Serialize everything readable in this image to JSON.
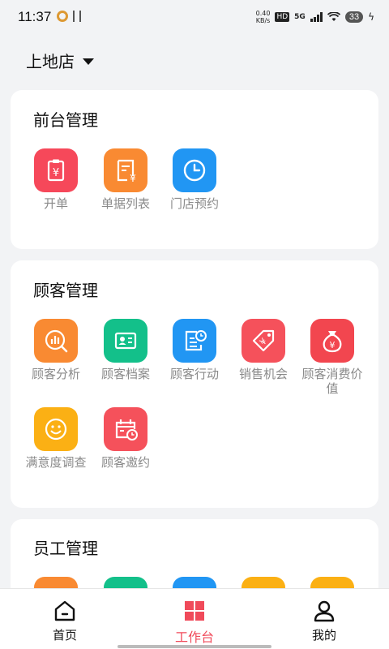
{
  "status_bar": {
    "time": "11:37",
    "net_speed_value": "0.40",
    "net_speed_unit": "KB/s",
    "hd": "HD",
    "network": "5G",
    "battery": "33",
    "left_icons": [
      "sync-icon",
      "usb-icon"
    ],
    "right_icons": [
      "signal-icon",
      "wifi-icon",
      "battery-icon",
      "charging-icon"
    ]
  },
  "store_selector": {
    "name": "上地店",
    "icon": "dropdown-caret-icon"
  },
  "sections": [
    {
      "title": "前台管理",
      "items": [
        {
          "label": "开单",
          "icon": "clipboard-yen-icon",
          "color": "#f6485a"
        },
        {
          "label": "单据列表",
          "icon": "receipt-list-icon",
          "color": "#f98a32"
        },
        {
          "label": "门店预约",
          "icon": "clock-icon",
          "color": "#2196f3"
        }
      ]
    },
    {
      "title": "顾客管理",
      "items": [
        {
          "label": "顾客分析",
          "icon": "chart-analysis-icon",
          "color": "#f98a32"
        },
        {
          "label": "顾客档案",
          "icon": "id-card-icon",
          "color": "#13c08a"
        },
        {
          "label": "顾客行动",
          "icon": "document-clock-icon",
          "color": "#2196f3"
        },
        {
          "label": "销售机会",
          "icon": "price-tag-icon",
          "color": "#f5515b"
        },
        {
          "label": "顾客消费价值",
          "icon": "money-bag-icon",
          "color": "#f2464f"
        },
        {
          "label": "满意度调查",
          "icon": "smiley-icon",
          "color": "#fbb014"
        },
        {
          "label": "顾客邀约",
          "icon": "calendar-clock-icon",
          "color": "#f5515b"
        }
      ]
    },
    {
      "title": "员工管理",
      "items": [
        {
          "icon": "tile-icon",
          "color": "#f98a32"
        },
        {
          "icon": "tile-icon",
          "color": "#13c08a"
        },
        {
          "icon": "tile-icon",
          "color": "#2196f3"
        },
        {
          "icon": "tile-icon",
          "color": "#fbb014"
        },
        {
          "icon": "tile-icon",
          "color": "#fbb014"
        }
      ]
    }
  ],
  "tab_bar": {
    "tabs": [
      {
        "label": "首页",
        "icon": "home-icon",
        "active": false
      },
      {
        "label": "工作台",
        "icon": "grid-icon",
        "active": true,
        "color": "#f04a5a"
      },
      {
        "label": "我的",
        "icon": "user-icon",
        "active": false
      }
    ]
  }
}
